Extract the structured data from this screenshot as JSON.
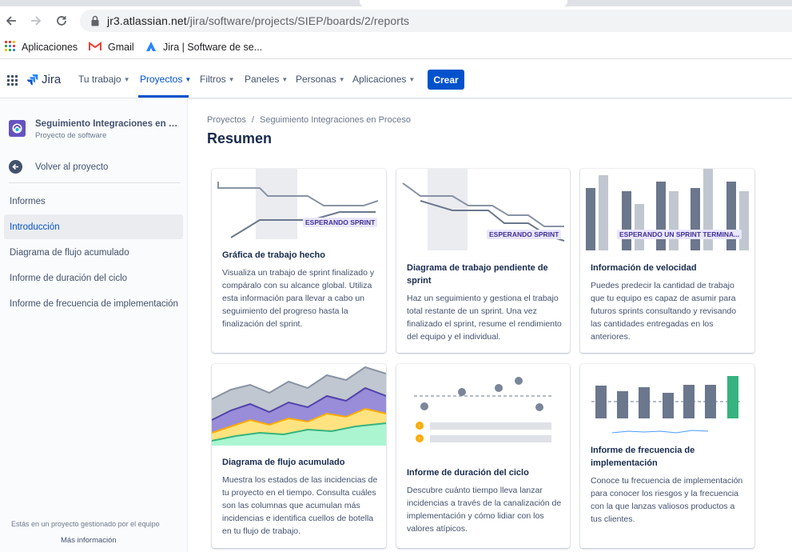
{
  "browser": {
    "url_host": "jr3.atlassian.net",
    "url_path": "/jira/software/projects/SIEP/boards/2/reports",
    "bookmarks": [
      {
        "label": "Aplicaciones",
        "icon": "apps-grid-icon"
      },
      {
        "label": "Gmail",
        "icon": "gmail-icon"
      },
      {
        "label": "Jira | Software de se...",
        "icon": "jira-icon"
      }
    ]
  },
  "topnav": {
    "logo_text": "Jira",
    "items": [
      "Tu trabajo",
      "Proyectos",
      "Filtros",
      "Paneles",
      "Personas",
      "Aplicaciones"
    ],
    "active_item": "Proyectos",
    "create_label": "Crear",
    "accent": "#0052cc"
  },
  "sidebar": {
    "project_name": "Seguimiento Integraciones en Pr...",
    "project_type": "Proyecto de software",
    "back_label": "Volver al proyecto",
    "section_title": "Informes",
    "items": [
      "Introducción",
      "Diagrama de flujo acumulado",
      "Informe de duración del ciclo",
      "Informe de frecuencia de implementación"
    ],
    "selected_item": "Introducción",
    "footer_note": "Estás en un proyecto gestionado por el equipo",
    "footer_link": "Más información"
  },
  "main": {
    "breadcrumb": [
      "Proyectos",
      "Seguimiento Integraciones en Proceso"
    ],
    "title": "Resumen",
    "cards": [
      {
        "title": "Gráfica de trabajo hecho",
        "description": "Visualiza un trabajo de sprint finalizado y compáralo con su alcance global. Utiliza esta información para llevar a cabo un seguimiento del progreso hasta la finalización del sprint.",
        "badge": "ESPERANDO SPRINT"
      },
      {
        "title": "Diagrama de trabajo pendiente de sprint",
        "description": "Haz un seguimiento y gestiona el trabajo total restante de un sprint. Una vez finalizado el sprint, resume el rendimiento del equipo y el individual.",
        "badge": "ESPERANDO SPRINT"
      },
      {
        "title": "Información de velocidad",
        "description": "Puedes predecir la cantidad de trabajo que tu equipo es capaz de asumir para futuros sprints consultando y revisando las cantidades entregadas en los anteriores.",
        "badge": "ESPERANDO UN SPRINT TERMINA..."
      },
      {
        "title": "Diagrama de flujo acumulado",
        "description": "Muestra los estados de las incidencias de tu proyecto en el tiempo. Consulta cuáles son las columnas que acumulan más incidencias e identifica cuellos de botella en tu flujo de trabajo."
      },
      {
        "title": "Informe de duración del ciclo",
        "description": "Descubre cuánto tiempo lleva lanzar incidencias a través de la canalización de implementación y cómo lidiar con los valores atípicos."
      },
      {
        "title": "Informe de frecuencia de implementación",
        "description": "Conoce tu frecuencia de implementación para conocer los riesgos y la frecuencia con la que lanzas valiosos productos a tus clientes."
      }
    ]
  }
}
